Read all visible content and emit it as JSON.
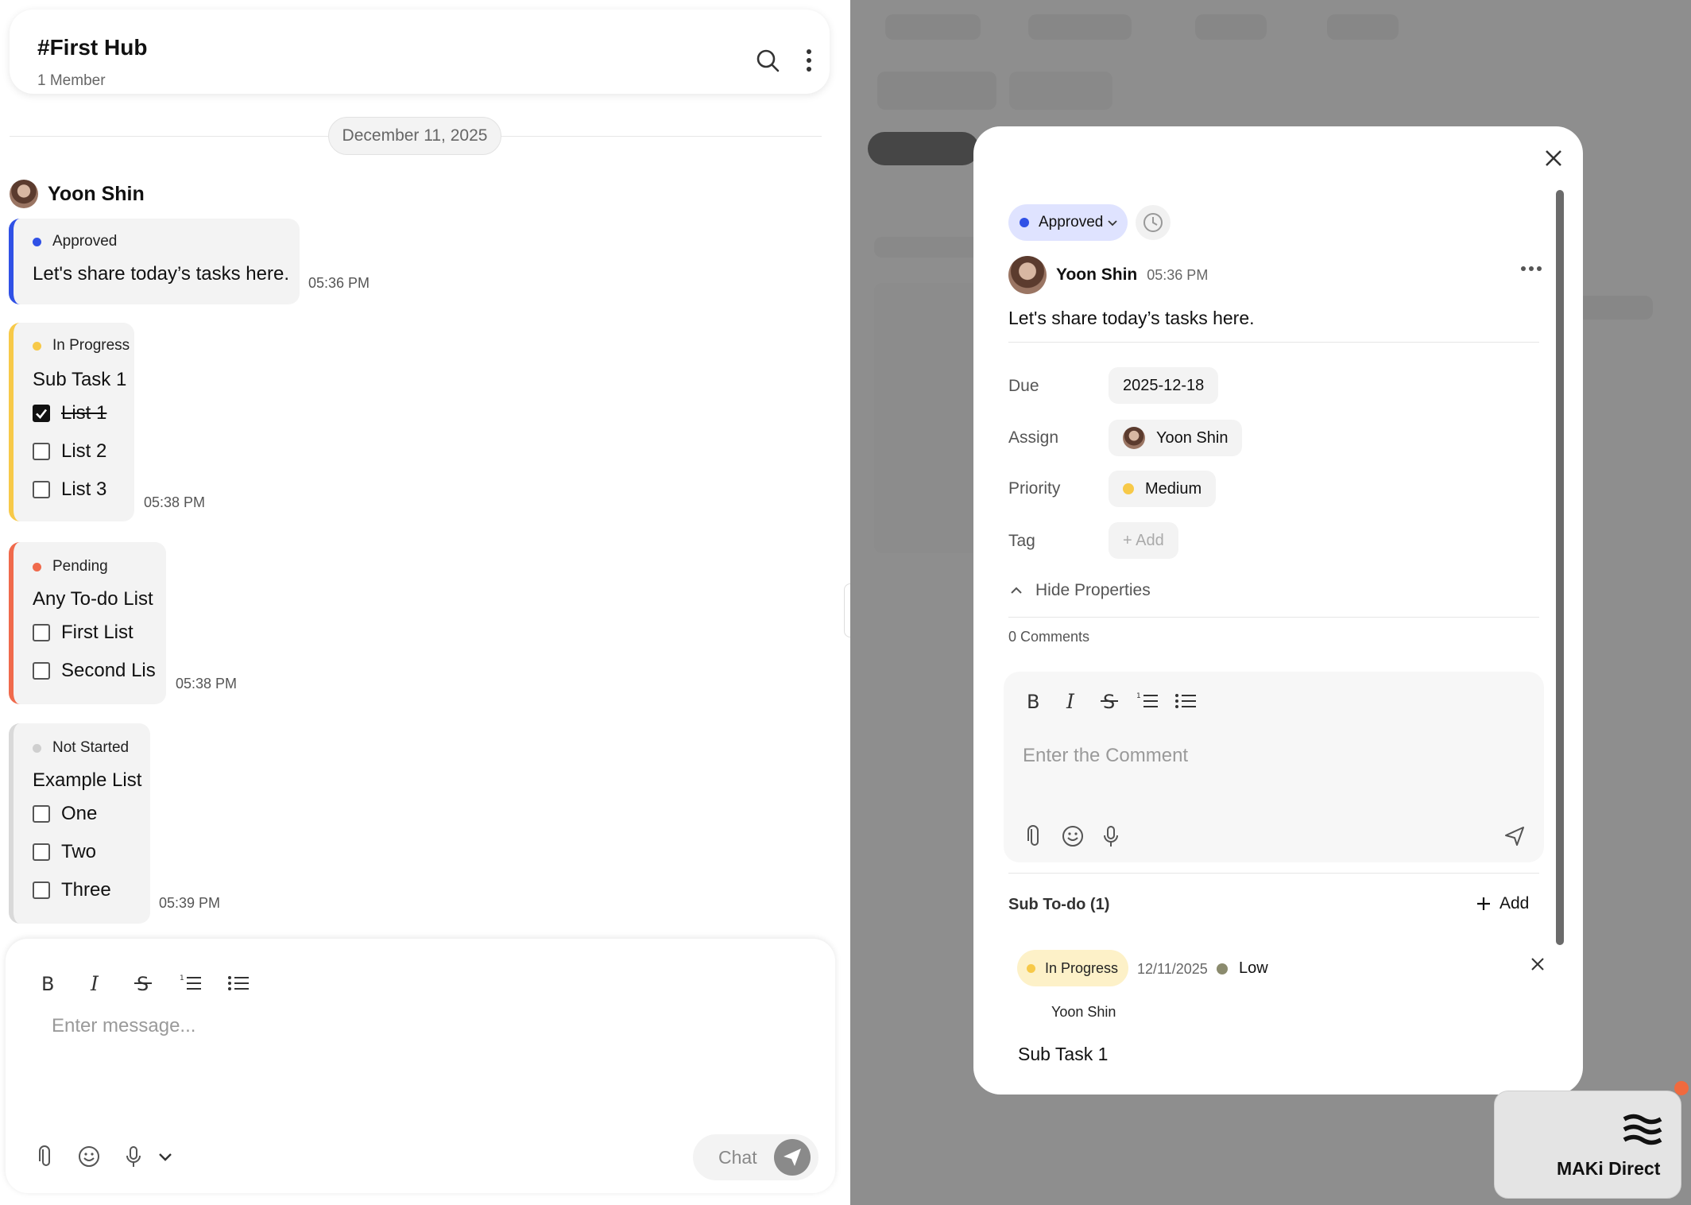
{
  "hub": {
    "title": "#First Hub",
    "members": "1 Member"
  },
  "date_divider": "December 11, 2025",
  "author": "Yoon Shin",
  "messages": [
    {
      "status": "Approved",
      "status_color": "#3051e6",
      "accent": "#3051e6",
      "text": "Let's share today’s tasks here.",
      "time": "05:36 PM"
    },
    {
      "status": "In Progress",
      "status_color": "#f7c948",
      "accent": "#f7c948",
      "title": "Sub Task 1",
      "items": [
        {
          "label": "List 1",
          "checked": true
        },
        {
          "label": "List 2",
          "checked": false
        },
        {
          "label": "List 3",
          "checked": false
        }
      ],
      "time": "05:38 PM"
    },
    {
      "status": "Pending",
      "status_color": "#f06a4c",
      "accent": "#f06a4c",
      "title": "Any To-do List",
      "items": [
        {
          "label": "First List",
          "checked": false
        },
        {
          "label": "Second Lis",
          "checked": false
        }
      ],
      "time": "05:38 PM"
    },
    {
      "status": "Not Started",
      "status_color": "#cfcfcf",
      "accent": "#d9d9d9",
      "title": "Example List",
      "items": [
        {
          "label": "One",
          "checked": false
        },
        {
          "label": "Two",
          "checked": false
        },
        {
          "label": "Three",
          "checked": false
        }
      ],
      "time": "05:39 PM"
    }
  ],
  "composer": {
    "placeholder": "Enter message...",
    "send_label": "Chat",
    "toolbar_icons": [
      "bold-icon",
      "italic-icon",
      "strikethrough-icon",
      "ordered-list-icon",
      "bullet-list-icon"
    ],
    "action_icons": [
      "paperclip-icon",
      "emoji-icon",
      "microphone-icon",
      "chevron-down-icon"
    ]
  },
  "modal": {
    "status": "Approved",
    "author": "Yoon Shin",
    "time": "05:36 PM",
    "body": "Let's share today’s tasks here.",
    "properties": {
      "due_label": "Due",
      "due_value": "2025-12-18",
      "assign_label": "Assign",
      "assign_value": "Yoon Shin",
      "priority_label": "Priority",
      "priority_value": "Medium",
      "priority_color": "#f7c948",
      "tag_label": "Tag",
      "tag_value": "+ Add"
    },
    "hide_properties": "Hide Properties",
    "comments_count": "0 Comments",
    "comment_placeholder": "Enter the Comment",
    "sub_todo": {
      "heading": "Sub To-do (1)",
      "add_label": "Add",
      "item": {
        "status": "In Progress",
        "date": "12/11/2025",
        "priority": "Low",
        "assignee": "Yoon Shin",
        "title": "Sub Task 1"
      }
    }
  },
  "maki": {
    "label": "MAKi Direct"
  }
}
